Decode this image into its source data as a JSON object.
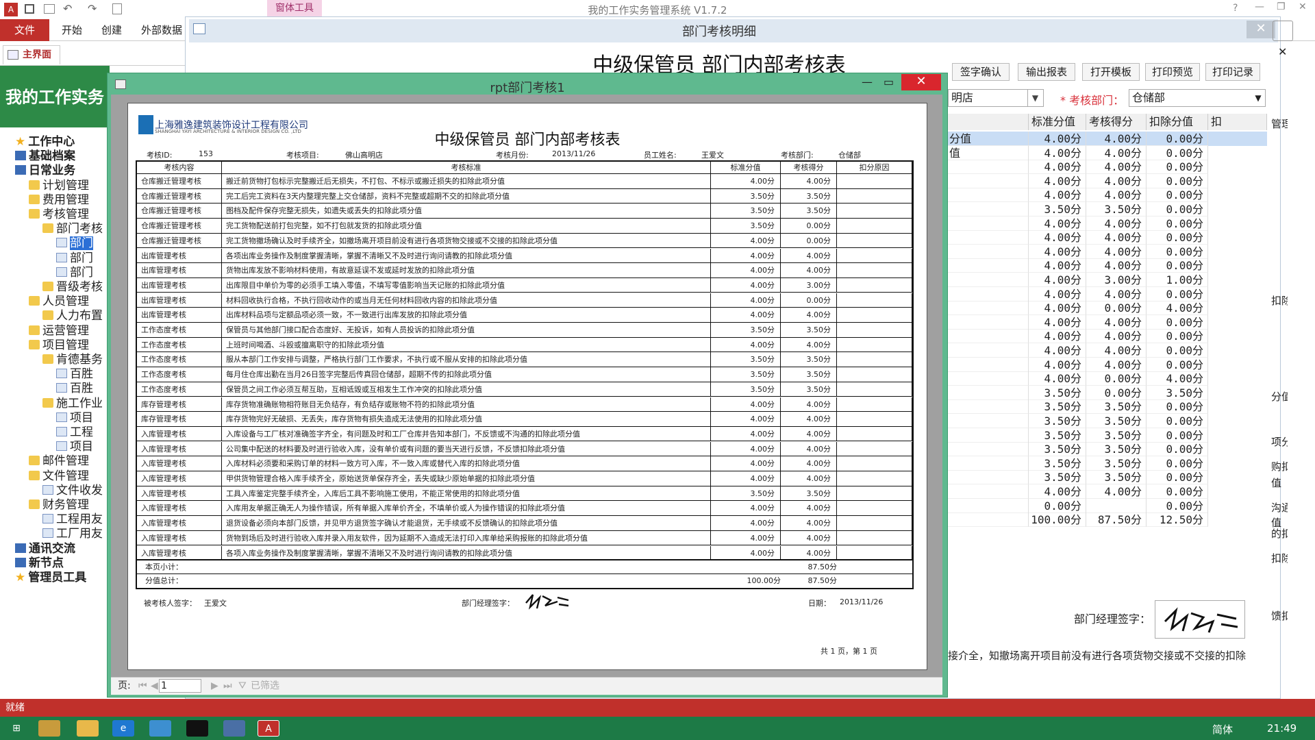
{
  "app": {
    "title": "我的工作实务管理系统 V1.7.2"
  },
  "ribbon": {
    "tabs": [
      "文件",
      "开始",
      "创建",
      "外部数据"
    ],
    "context_tab": "窗体工具"
  },
  "nav": {
    "tab": "主界面",
    "banner": "我的工作实务",
    "tree": [
      "工作中心",
      "基础档案",
      "日常业务",
      "计划管理",
      "费用管理",
      "考核管理",
      "部门考核",
      "部门",
      "部门",
      "部门",
      "晋级考核",
      "人员管理",
      "人力布置",
      "运营管理",
      "项目管理",
      "肯德基务",
      "百胜",
      "百胜",
      "施工作业",
      "项目",
      "工程",
      "项目",
      "邮件管理",
      "文件管理",
      "文件收发",
      "财务管理",
      "工程用友",
      "工厂用友",
      "通讯交流",
      "新节点",
      "管理员工具"
    ]
  },
  "status": {
    "text": "就绪"
  },
  "taskbar": {
    "time": "21:49",
    "ime": "简体"
  },
  "detail": {
    "window_title": "部门考核明细",
    "heading": "中级保管员 部门内部考核表",
    "buttons": [
      "签字确认",
      "输出报表",
      "打开模板",
      "打印预览",
      "打印记录"
    ],
    "store_value": "明店",
    "dept_label": "* 考核部门：",
    "dept_value": "仓储部",
    "grid_headers": [
      "",
      "标准分值",
      "考核得分",
      "扣除分值",
      "扣"
    ],
    "grid_rows": [
      [
        "分值",
        "4.00分",
        "4.00分",
        "0.00分"
      ],
      [
        "值",
        "4.00分",
        "4.00分",
        "0.00分"
      ],
      [
        "",
        "4.00分",
        "4.00分",
        "0.00分"
      ],
      [
        "",
        "4.00分",
        "4.00分",
        "0.00分"
      ],
      [
        "",
        "4.00分",
        "4.00分",
        "0.00分"
      ],
      [
        "",
        "3.50分",
        "3.50分",
        "0.00分"
      ],
      [
        "",
        "4.00分",
        "4.00分",
        "0.00分"
      ],
      [
        "",
        "4.00分",
        "4.00分",
        "0.00分"
      ],
      [
        "",
        "4.00分",
        "4.00分",
        "0.00分"
      ],
      [
        "",
        "4.00分",
        "4.00分",
        "0.00分"
      ],
      [
        "",
        "4.00分",
        "3.00分",
        "1.00分"
      ],
      [
        "",
        "4.00分",
        "4.00分",
        "0.00分"
      ],
      [
        "",
        "4.00分",
        "0.00分",
        "4.00分"
      ],
      [
        "",
        "4.00分",
        "4.00分",
        "0.00分"
      ],
      [
        "",
        "4.00分",
        "4.00分",
        "0.00分"
      ],
      [
        "",
        "4.00分",
        "4.00分",
        "0.00分"
      ],
      [
        "",
        "4.00分",
        "4.00分",
        "0.00分"
      ],
      [
        "",
        "4.00分",
        "0.00分",
        "4.00分"
      ],
      [
        "",
        "3.50分",
        "0.00分",
        "3.50分"
      ],
      [
        "",
        "3.50分",
        "3.50分",
        "0.00分"
      ],
      [
        "",
        "3.50分",
        "3.50分",
        "0.00分"
      ],
      [
        "",
        "3.50分",
        "3.50分",
        "0.00分"
      ],
      [
        "",
        "3.50分",
        "3.50分",
        "0.00分"
      ],
      [
        "",
        "3.50分",
        "3.50分",
        "0.00分"
      ],
      [
        "",
        "3.50分",
        "3.50分",
        "0.00分"
      ],
      [
        "",
        "4.00分",
        "4.00分",
        "0.00分"
      ],
      [
        "",
        "0.00分",
        "",
        "0.00分"
      ],
      [
        "",
        "100.00分",
        "87.50分",
        "12.50分"
      ]
    ],
    "right_snippets": [
      "管理员",
      "扣除",
      "分值",
      "项分",
      "购扣",
      "值",
      "沟通",
      "值",
      "的扣",
      "扣除",
      "馈扣"
    ],
    "mgr_sig_label": "部门经理签字：",
    "note": "接介全，知撤场离开项目前没有进行各项货物交接或不交接的扣除"
  },
  "report": {
    "window_title": "rpt部门考核1",
    "company": "上海雅逸建筑装饰设计工程有限公司",
    "company_en": "SHANGHAI YAYI ARCHITECTURE & INTERIOR DESIGN CO. ,LTD",
    "heading": "中级保管员 部门内部考核表",
    "meta": [
      "考核ID:",
      "153",
      "考核项目:",
      "佛山高明店",
      "考核月份:",
      "2013/11/26",
      "员工姓名:",
      "王爱文",
      "考核部门:",
      "仓储部"
    ],
    "headers": [
      "考核内容",
      "考核标准",
      "标准分值",
      "考核得分",
      "扣分原因"
    ],
    "rows": [
      [
        "仓库搬迁管理考核",
        "搬迁前货物打包标示完整搬迁后无损失，不打包、不标示或搬迁损失的扣除此项分值",
        "4.00分",
        "4.00分"
      ],
      [
        "仓库搬迁管理考核",
        "完工后完工资料在3天内整理完整上交仓储部，资料不完整或超期不交的扣除此项分值",
        "3.50分",
        "3.50分"
      ],
      [
        "仓库搬迁管理考核",
        "图档及配件保存完整无损失，如遗失或丢失的扣除此项分值",
        "3.50分",
        "3.50分"
      ],
      [
        "仓库搬迁管理考核",
        "完工货物配送前打包完整，如不打包就发货的扣除此项分值",
        "3.50分",
        "0.00分"
      ],
      [
        "仓库搬迁管理考核",
        "完工货物撤场确认及时手续齐全，如撤场离开项目前没有进行各项货物交接或不交接的扣除此项分值",
        "4.00分",
        "0.00分"
      ],
      [
        "出库管理考核",
        "各项出库业务操作及制度掌握清晰，掌握不清晰又不及时进行询问请教的扣除此项分值",
        "4.00分",
        "4.00分"
      ],
      [
        "出库管理考核",
        "货物出库发放不影响材料使用，有故意延误不发或延时发放的扣除此项分值",
        "4.00分",
        "4.00分"
      ],
      [
        "出库管理考核",
        "出库限目中单价为零的必须手工填入零值，不填写零值影响当天记账的扣除此项分值",
        "4.00分",
        "3.00分"
      ],
      [
        "出库管理考核",
        "材料回收执行合格，不执行回收动作的或当月无任何材料回收内容的扣除此项分值",
        "4.00分",
        "0.00分"
      ],
      [
        "出库管理考核",
        "出库材料品项与定额品项必须一致，不一致进行出库发放的扣除此项分值",
        "4.00分",
        "4.00分"
      ],
      [
        "工作态度考核",
        "保管员与其他部门接口配合态度好、无投诉，如有人员投诉的扣除此项分值",
        "3.50分",
        "3.50分"
      ],
      [
        "工作态度考核",
        "上班时间喝酒、斗殴或擅离职守的扣除此项分值",
        "4.00分",
        "4.00分"
      ],
      [
        "工作态度考核",
        "服从本部门工作安排与调整，严格执行部门工作要求，不执行或不服从安排的扣除此项分值",
        "3.50分",
        "3.50分"
      ],
      [
        "工作态度考核",
        "每月住仓库出勤在当月26日签字完整后传真回仓储部，超期不传的扣除此项分值",
        "3.50分",
        "3.50分"
      ],
      [
        "工作态度考核",
        "保管员之间工作必须互帮互助，互相诋毁或互相发生工作冲突的扣除此项分值",
        "3.50分",
        "3.50分"
      ],
      [
        "库存管理考核",
        "库存货物准确账物相符账目无负结存，有负结存或账物不符的扣除此项分值",
        "4.00分",
        "4.00分"
      ],
      [
        "库存管理考核",
        "库存货物完好无破损、无丢失，库存货物有损失造成无法使用的扣除此项分值",
        "4.00分",
        "4.00分"
      ],
      [
        "入库管理考核",
        "入库设备与工厂核对准确签字齐全，有问题及时和工厂仓库并告知本部门，不反馈或不沟通的扣除此项分值",
        "4.00分",
        "4.00分"
      ],
      [
        "入库管理考核",
        "公司集中配送的材料要及时进行验收入库，没有单价或有问题的要当天进行反馈，不反馈扣除此项分值",
        "4.00分",
        "4.00分"
      ],
      [
        "入库管理考核",
        "入库材料必须要和采购订单的材料一致方可入库，不一致入库或替代入库的扣除此项分值",
        "4.00分",
        "4.00分"
      ],
      [
        "入库管理考核",
        "甲供货物管理合格入库手续齐全，原始送货单保存齐全，丢失或缺少原始单据的扣除此项分值",
        "4.00分",
        "4.00分"
      ],
      [
        "入库管理考核",
        "工具入库鉴定完整手续齐全，入库后工具不影响施工使用，不能正常使用的扣除此项分值",
        "3.50分",
        "3.50分"
      ],
      [
        "入库管理考核",
        "入库用友单据正确无人为操作错误，所有单据入库单价齐全，不填单价或人为操作错误的扣除此项分值",
        "4.00分",
        "4.00分"
      ],
      [
        "入库管理考核",
        "退货设备必须向本部门反馈，并见甲方退货签字确认才能退货，无手续或不反馈确认的扣除此项分值",
        "4.00分",
        "4.00分"
      ],
      [
        "入库管理考核",
        "货物到场后及时进行验收入库并录入用友软件，因为延期不入造成无法打印入库单给采购报账的扣除此项分值",
        "4.00分",
        "4.00分"
      ],
      [
        "入库管理考核",
        "各项入库业务操作及制度掌握清晰，掌握不清晰又不及时进行询问请教的扣除此项分值",
        "4.00分",
        "4.00分"
      ]
    ],
    "subtotal_label": "本页小计：",
    "subtotal": "87.50分",
    "total_label": "分值总计：",
    "total_std": "100.00分",
    "total_score": "87.50分",
    "sign_examinee_label": "被考核人签字：",
    "sign_examinee": "王爱文",
    "sign_mgr_label": "部门经理签字：",
    "date_label": "日期：",
    "date": "2013/11/26",
    "page_info": "共 1 页，第 1 页",
    "nav_label": "页:",
    "page": "1",
    "filter": "已筛选"
  }
}
